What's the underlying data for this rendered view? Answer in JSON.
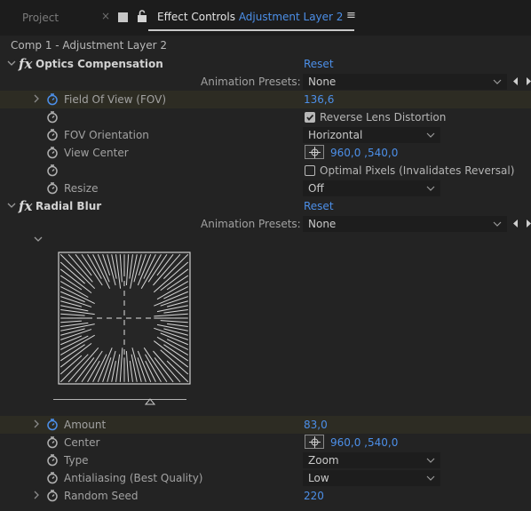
{
  "tabs": {
    "project": "Project",
    "effect_controls": "Effect Controls",
    "layer_name": "Adjustment Layer 2",
    "close": "×",
    "menu": "≡"
  },
  "breadcrumb": "Comp 1 - Adjustment Layer 2",
  "effects": [
    {
      "name": "Optics Compensation",
      "reset": "Reset",
      "animation_presets_label": "Animation Presets:",
      "animation_presets_value": "None",
      "properties": {
        "fov_label": "Field Of View (FOV)",
        "fov_value": "136,6",
        "reverse_label": "Reverse Lens Distortion",
        "reverse_checked": true,
        "fov_orientation_label": "FOV Orientation",
        "fov_orientation_value": "Horizontal",
        "view_center_label": "View Center",
        "view_center_value": "960,0 ,540,0",
        "optimal_label": "Optimal Pixels (Invalidates Reversal)",
        "optimal_checked": false,
        "resize_label": "Resize",
        "resize_value": "Off"
      }
    },
    {
      "name": "Radial Blur",
      "reset": "Reset",
      "animation_presets_label": "Animation Presets:",
      "animation_presets_value": "None",
      "properties": {
        "amount_label": "Amount",
        "amount_value": "83,0",
        "center_label": "Center",
        "center_value": "960,0 ,540,0",
        "type_label": "Type",
        "type_value": "Zoom",
        "antialiasing_label": "Antialiasing (Best Quality)",
        "antialiasing_value": "Low",
        "random_seed_label": "Random Seed",
        "random_seed_value": "220"
      }
    }
  ],
  "colors": {
    "panel_bg": "#232323",
    "accent_blue": "#4c8fe8",
    "highlight_row": "#2d2c23",
    "dropdown_bg": "#1d1d1d"
  },
  "icons": [
    "lock-icon",
    "stopwatch-icon",
    "chevron-down-icon",
    "chevron-right-icon",
    "nav-left-icon",
    "nav-right-icon",
    "point-control-icon"
  ]
}
